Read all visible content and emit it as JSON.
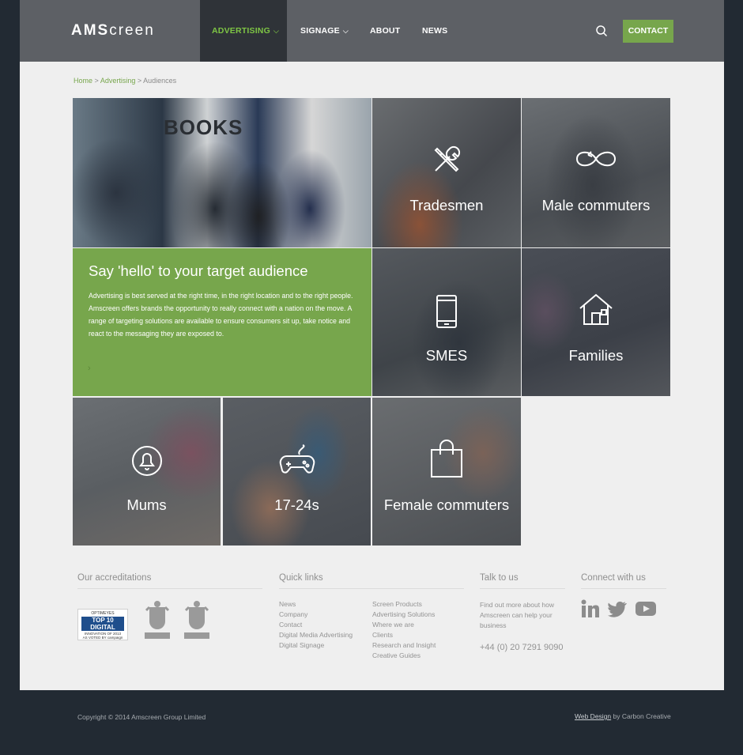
{
  "header": {
    "logo_bold": "AMS",
    "logo_light": "creen",
    "nav": [
      {
        "label": "ADVERTISING",
        "active": true
      },
      {
        "label": "SIGNAGE"
      },
      {
        "label": "ABOUT"
      },
      {
        "label": "NEWS"
      }
    ],
    "chevron": "⌵",
    "contact_label": "CONTACT",
    "accent_color": "#7ec544"
  },
  "breadcrumb": {
    "home": "Home",
    "sep": ">",
    "section": "Advertising",
    "current": "Audiences"
  },
  "hero": {
    "sign_text": "BOOKS"
  },
  "intro": {
    "title": "Say 'hello' to your target audience",
    "body": "Advertising is best served at the right time, in the right location and to the right people. Amscreen offers brands the opportunity to really connect with a nation on the move. A range of targeting solutions are available to ensure consumers sit up, take notice and react to the messaging they are exposed to.",
    "arrow": "›",
    "color": "#77a64c"
  },
  "tiles": [
    {
      "label": "Tradesmen",
      "icon": "tools-icon"
    },
    {
      "label": "Male commuters",
      "icon": "infinity-icon"
    },
    {
      "label": "SMES",
      "icon": "mobile-icon"
    },
    {
      "label": "Families",
      "icon": "house-icon"
    },
    {
      "label": "Mums",
      "icon": "bell-icon"
    },
    {
      "label": "17-24s",
      "icon": "gamepad-icon"
    },
    {
      "label": "Female commuters",
      "icon": "shopping-bag-icon"
    }
  ],
  "footer": {
    "accreditations": {
      "heading": "Our accreditations",
      "badge_top": "OPTIMEYES",
      "badge_main": "TOP 10 DIGITAL",
      "badge_sub": "INNOVATION OF 2013",
      "badge_voted": "AS VOTED BY campaign",
      "winner": "WINNER"
    },
    "quick_links": {
      "heading": "Quick links",
      "col1": [
        "News",
        "Company",
        "Contact",
        "Digital Media Advertising",
        "Digital Signage"
      ],
      "col2": [
        "Screen Products",
        "Advertising Solutions",
        "Where we are",
        "Clients",
        "Research and Insight",
        "Creative Guides"
      ]
    },
    "talk": {
      "heading": "Talk to us",
      "text": "Find out more about how Amscreen can help your business",
      "phone": "+44 (0) 20 7291 9090"
    },
    "connect": {
      "heading": "Connect with us",
      "icons": [
        "linkedin-icon",
        "twitter-icon",
        "youtube-icon"
      ]
    }
  },
  "bottom": {
    "copyright": "Copyright © 2014 Amscreen Group Limited",
    "credit_link": "Web Design",
    "credit_rest": " by Carbon Creative"
  }
}
